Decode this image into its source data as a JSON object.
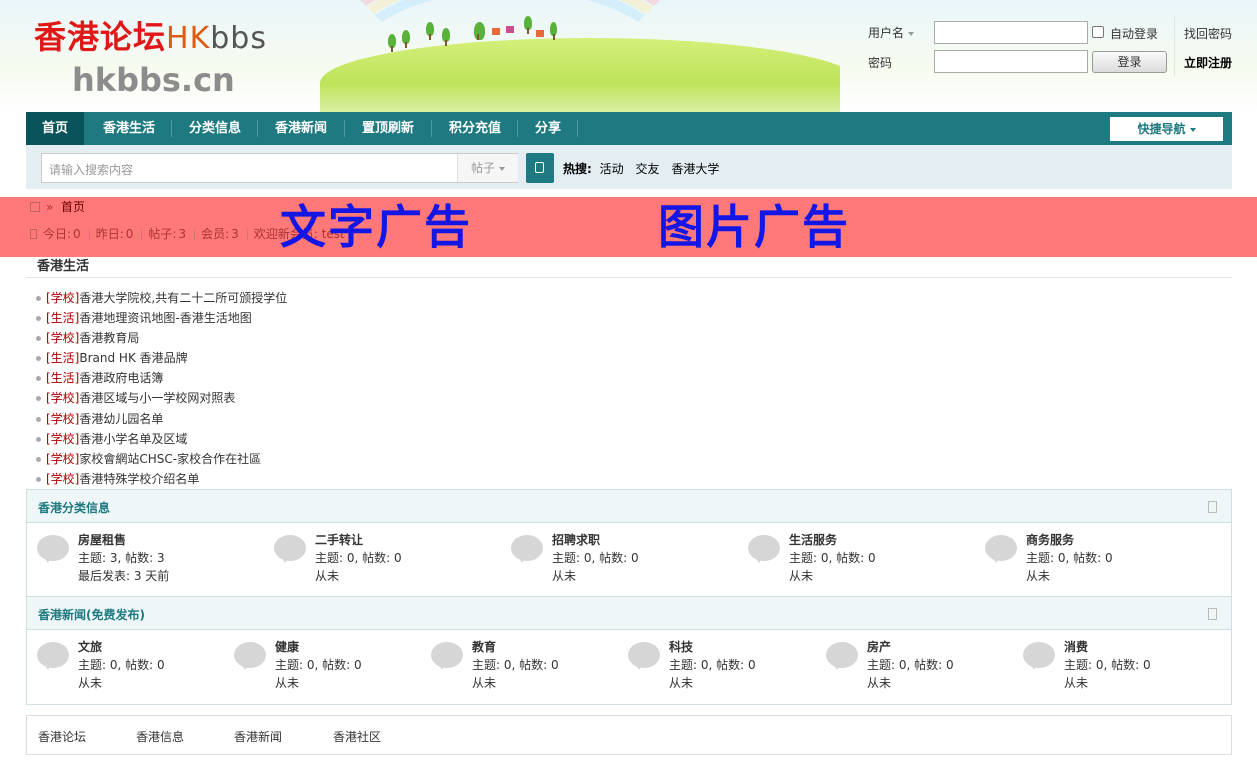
{
  "header": {
    "logo": {
      "cn": "香港论坛",
      "hk": "HK",
      "bbs": "bbs",
      "domain": "hkbbs.cn"
    },
    "login": {
      "username_label": "用户名",
      "password_label": "密码",
      "username_value": "",
      "password_value": "",
      "remember_label": "自动登录",
      "login_button": "登录",
      "forgot_link": "找回密码",
      "register_link": "立即注册"
    }
  },
  "nav": {
    "items": [
      {
        "label": "首页",
        "active": true
      },
      {
        "label": "香港生活"
      },
      {
        "label": "分类信息"
      },
      {
        "label": "香港新闻"
      },
      {
        "label": "置顶刷新"
      },
      {
        "label": "积分充值"
      },
      {
        "label": "分享"
      }
    ],
    "quick_nav": "快捷导航"
  },
  "search": {
    "placeholder": "请输入搜索内容",
    "type_label": "帖子",
    "hot_label": "热搜:",
    "hot_terms": [
      "活动",
      "交友",
      "香港大学"
    ]
  },
  "breadcrumb": {
    "sep": "»",
    "current": "首页"
  },
  "stats": {
    "today_label": "今日:",
    "today": "0",
    "yesterday_label": "昨日:",
    "yesterday": "0",
    "posts_label": "帖子:",
    "posts": "3",
    "members_label": "会员:",
    "members": "3",
    "welcome": "欢迎新会员: test"
  },
  "ads": {
    "text_ad": "文字广告",
    "image_ad": "图片广告"
  },
  "life": {
    "title": "香港生活",
    "items": [
      {
        "tag": "[学校]",
        "text": "香港大学院校,共有二十二所可颁授学位"
      },
      {
        "tag": "[生活]",
        "text": "香港地理资讯地图-香港生活地图"
      },
      {
        "tag": "[学校]",
        "text": "香港教育局"
      },
      {
        "tag": "[生活]",
        "text": "Brand HK 香港品牌"
      },
      {
        "tag": "[生活]",
        "text": "香港政府电话簿"
      },
      {
        "tag": "[学校]",
        "text": "香港区域与小一学校网对照表"
      },
      {
        "tag": "[学校]",
        "text": "香港幼儿园名单"
      },
      {
        "tag": "[学校]",
        "text": "香港小学名单及区域"
      },
      {
        "tag": "[学校]",
        "text": "家校會網站CHSC-家校合作在社區"
      },
      {
        "tag": "[学校]",
        "text": "香港特殊学校介绍名单"
      }
    ]
  },
  "classified": {
    "title": "香港分类信息",
    "forums": [
      {
        "name": "房屋租售",
        "stat": "主题: 3, 帖数: 3",
        "last": "最后发表: 3 天前"
      },
      {
        "name": "二手转让",
        "stat": "主题: 0, 帖数: 0",
        "last": "从未"
      },
      {
        "name": "招聘求职",
        "stat": "主题: 0, 帖数: 0",
        "last": "从未"
      },
      {
        "name": "生活服务",
        "stat": "主题: 0, 帖数: 0",
        "last": "从未"
      },
      {
        "name": "商务服务",
        "stat": "主题: 0, 帖数: 0",
        "last": "从未"
      }
    ]
  },
  "news": {
    "title": "香港新闻(免费发布)",
    "forums": [
      {
        "name": "文旅",
        "stat": "主题: 0, 帖数: 0",
        "last": "从未"
      },
      {
        "name": "健康",
        "stat": "主题: 0, 帖数: 0",
        "last": "从未"
      },
      {
        "name": "教育",
        "stat": "主题: 0, 帖数: 0",
        "last": "从未"
      },
      {
        "name": "科技",
        "stat": "主题: 0, 帖数: 0",
        "last": "从未"
      },
      {
        "name": "房产",
        "stat": "主题: 0, 帖数: 0",
        "last": "从未"
      },
      {
        "name": "消费",
        "stat": "主题: 0, 帖数: 0",
        "last": "从未"
      }
    ]
  },
  "footer": {
    "links": [
      "香港论坛",
      "香港信息",
      "香港新闻",
      "香港社区"
    ]
  }
}
